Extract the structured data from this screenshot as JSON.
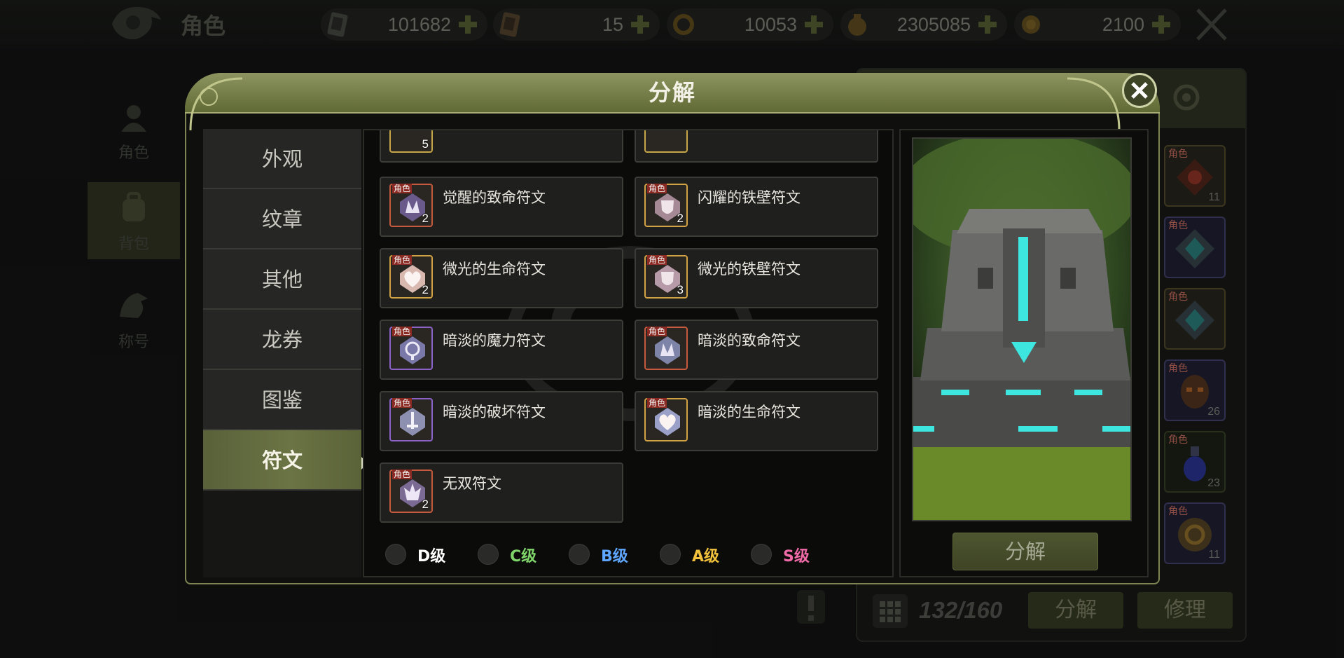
{
  "header": {
    "title": "角色",
    "currencies": [
      {
        "icon": "card-ticket-icon",
        "value": "101682"
      },
      {
        "icon": "scroll-card-icon",
        "value": "15"
      },
      {
        "icon": "ring-coin-icon",
        "value": "10053"
      },
      {
        "icon": "gold-bag-icon",
        "value": "2305085"
      },
      {
        "icon": "gold-coin-icon",
        "value": "2100"
      }
    ]
  },
  "sidebar": {
    "items": [
      {
        "label": "角色",
        "icon": "character-icon"
      },
      {
        "label": "背包",
        "icon": "backpack-icon"
      },
      {
        "label": "称号",
        "icon": "dragon-title-icon"
      }
    ]
  },
  "inventory": {
    "slots": [
      {
        "tag": "角色",
        "count": "11"
      },
      {
        "tag": "角色",
        "count": ""
      },
      {
        "tag": "角色",
        "count": ""
      },
      {
        "tag": "角色",
        "count": "26"
      },
      {
        "tag": "角色",
        "count": "23"
      },
      {
        "tag": "角色",
        "count": "11"
      }
    ],
    "capacity": "132/160",
    "decompose_label": "分解",
    "repair_label": "修理"
  },
  "modal": {
    "title": "分解",
    "tabs": [
      "外观",
      "纹章",
      "其他",
      "龙券",
      "图鉴",
      "符文"
    ],
    "active_tab": "符文",
    "partial_items": [
      {
        "count": "5",
        "color": "#c7a64a"
      },
      {
        "count": "",
        "color": "#c7a64a"
      }
    ],
    "items": [
      {
        "name": "觉醒的致命符文",
        "tag": "角色",
        "count": "2",
        "border": "#c65a3e",
        "icon": "spike-rune-icon",
        "fill": "#6a5a8c"
      },
      {
        "name": "闪耀的铁壁符文",
        "tag": "角色",
        "count": "2",
        "border": "#d2a345",
        "icon": "shield-rune-icon",
        "fill": "#a58a96"
      },
      {
        "name": "微光的生命符文",
        "tag": "角色",
        "count": "2",
        "border": "#d2a345",
        "icon": "heart-rune-icon",
        "fill": "#d9b8b0"
      },
      {
        "name": "微光的铁壁符文",
        "tag": "角色",
        "count": "3",
        "border": "#d2a345",
        "icon": "shield-rune-icon",
        "fill": "#b69aa8"
      },
      {
        "name": "暗淡的魔力符文",
        "tag": "角色",
        "count": "",
        "border": "#8a62c8",
        "icon": "magic-rune-icon",
        "fill": "#7a78a8"
      },
      {
        "name": "暗淡的致命符文",
        "tag": "角色",
        "count": "",
        "border": "#c65a3e",
        "icon": "spike-rune-icon",
        "fill": "#7d84a8"
      },
      {
        "name": "暗淡的破坏符文",
        "tag": "角色",
        "count": "",
        "border": "#8a62c8",
        "icon": "sword-rune-icon",
        "fill": "#8d90b0"
      },
      {
        "name": "暗淡的生命符文",
        "tag": "角色",
        "count": "",
        "border": "#d2a345",
        "icon": "heart-rune-icon",
        "fill": "#9aa0c8"
      },
      {
        "name": "无双符文",
        "tag": "角色",
        "count": "2",
        "border": "#c65a3e",
        "icon": "peerless-rune-icon",
        "fill": "#7a6a94"
      }
    ],
    "grades": [
      {
        "label": "D级",
        "color": "#ffffff"
      },
      {
        "label": "C级",
        "color": "#7fd46a"
      },
      {
        "label": "B级",
        "color": "#5fa6ff"
      },
      {
        "label": "A级",
        "color": "#f2c23c"
      },
      {
        "label": "S级",
        "color": "#f06aa8"
      }
    ],
    "decompose_button": "分解"
  },
  "colors": {
    "accent_olive": "#6b7444",
    "frame_gold": "#7e8553"
  }
}
